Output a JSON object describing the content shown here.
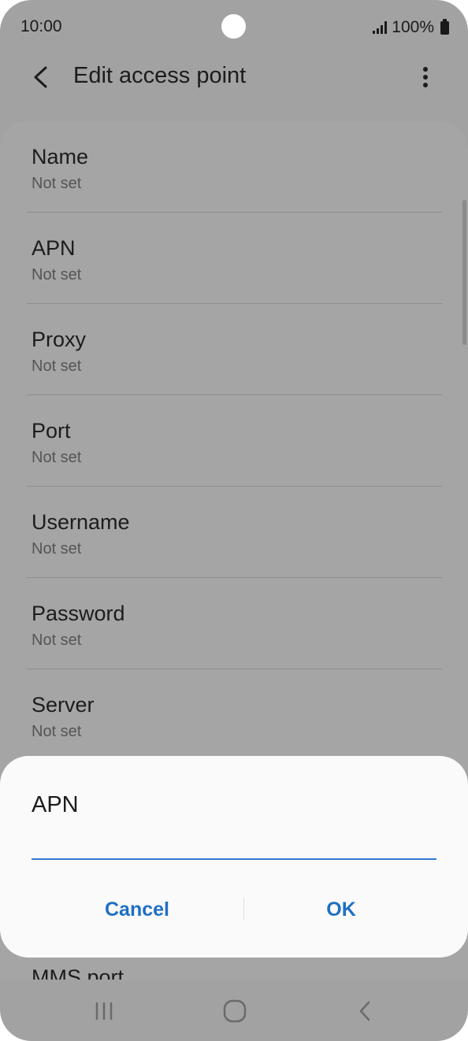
{
  "status_bar": {
    "time": "10:00",
    "battery": "100%"
  },
  "app_bar": {
    "title": "Edit access point"
  },
  "settings": [
    {
      "label": "Name",
      "value": "Not set"
    },
    {
      "label": "APN",
      "value": "Not set"
    },
    {
      "label": "Proxy",
      "value": "Not set"
    },
    {
      "label": "Port",
      "value": "Not set"
    },
    {
      "label": "Username",
      "value": "Not set"
    },
    {
      "label": "Password",
      "value": "Not set"
    },
    {
      "label": "Server",
      "value": "Not set"
    },
    {
      "label": "MMS port",
      "value": ""
    }
  ],
  "dialog": {
    "title": "APN",
    "input_value": "",
    "cancel_label": "Cancel",
    "ok_label": "OK"
  },
  "colors": {
    "accent": "#1f6fc5",
    "input_underline": "#2d7dd2",
    "scrim": "#a2a2a2"
  },
  "icons": {
    "back": "back-arrow-icon",
    "more": "more-vert-icon",
    "recent": "recent-apps-icon",
    "home": "home-icon",
    "nav_back": "nav-back-icon"
  }
}
